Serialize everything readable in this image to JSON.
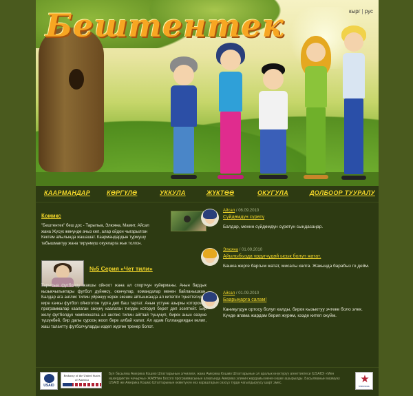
{
  "site": {
    "logo_text": "Бештентек"
  },
  "lang": {
    "kg": "кырг",
    "sep": "|",
    "ru": "рус"
  },
  "nav": [
    {
      "label": "КААРМАНДАР"
    },
    {
      "label": "КӨРГҮЛӨ"
    },
    {
      "label": "УККУЛА"
    },
    {
      "label": "ЖҮКТӨӨ"
    },
    {
      "label": "ОКУГУЛА"
    },
    {
      "label": "ДОЛБООР ТУУРАЛУ"
    }
  ],
  "comics": {
    "title": "Комикс",
    "text": "\"Бештентек\" беш дос - Тарыпыа, Элюяна, Мамит, Айсал жана Жүсүк жөнүндө ачыз кеп, алар ойдон чыгарылган Кектем айылында жашашат. Каармандардын турмушу табышмактуу жана тирүнмүш окуяларга жык толгон."
  },
  "series": {
    "title": "№5 Серия «Чет тили»",
    "text": "Тарыпыа футболду жакшы ойноот жана ал спортчун куйөрманы. Анын бардык кызыкчылыктары футбол дүйнөсү, оюнчулар, командалар менен байланышкан. Балдар ага англис тилин үйрөнүү керек экенин айтышканда ал китепти түнөттегиден кире качкы футбол ойноготон турга деп баш тартат. Анын устуне азыркы которомчу программалар каалаган сөзүнү каалаган тилден которуп берет деп эсептейт. Бир жолу футболдук чемпионатка ал англис тилин айтпай түшүнүп, бирок анын сөзүнө түшүнбөй, бир далы сурооң жооп бере албай калат. Ал адам Голландиядан келип, жаш талантту футболчуларды издеп жүргөн тренер болот."
  },
  "posts": [
    {
      "name": "Айсал",
      "date": "06.09.2010",
      "title": "Сүйдөмдүн сүрөтү",
      "text": "Балдар, менин сүйдөмдүн сүрөтүн сындасаңар.",
      "hair_color": "#2a3f7a"
    },
    {
      "name": "Элюяна",
      "date": "01.09.2010",
      "title": "Айылыбызда үрдүгчүдөй ысык болуп жатат.",
      "text": "Башка жерге баргым жатат, мисалы көлгө. Жакында барабыз го дейм.",
      "hair_color": "#e5a820"
    },
    {
      "name": "Айсал",
      "date": "01.09.2010",
      "title": "Баарыңарга салам!",
      "text": "Каникулдун ортосу болуп калды, бирок кызыктуу эчтеке боло элек. Күндө апама жардам берип жүрөм, кээде китеп окуйм.",
      "hair_color": "#2a3f7a"
    }
  ],
  "footer": {
    "usaid_label": "USAID",
    "embassy_label": "Embassy of the United States of America",
    "partner_label": "Internews",
    "text": "Бул басылма Америка Кошмо Штаттарынын элчилиги, жана Америка Кошмо Штаттарынын эл аралык өнүктүрүү агенттиктеси (USAID) «Мен ишкердиктин чачырчы» ЖАӨНин Босого программасынын алкагында Америка элинин жардамы менен ишке ашырылды. Басылманын мазмуну USAID же Америка Кошмо Штаттарынын өкмөтүнүн көз караштарын сөзсүз түрдө чагылдыруусу шарт эмес."
  },
  "colors": {
    "accent": "#f1d52a",
    "background": "#2d3a12",
    "outer": "#4a5a1e",
    "logo": "#f7a622"
  }
}
